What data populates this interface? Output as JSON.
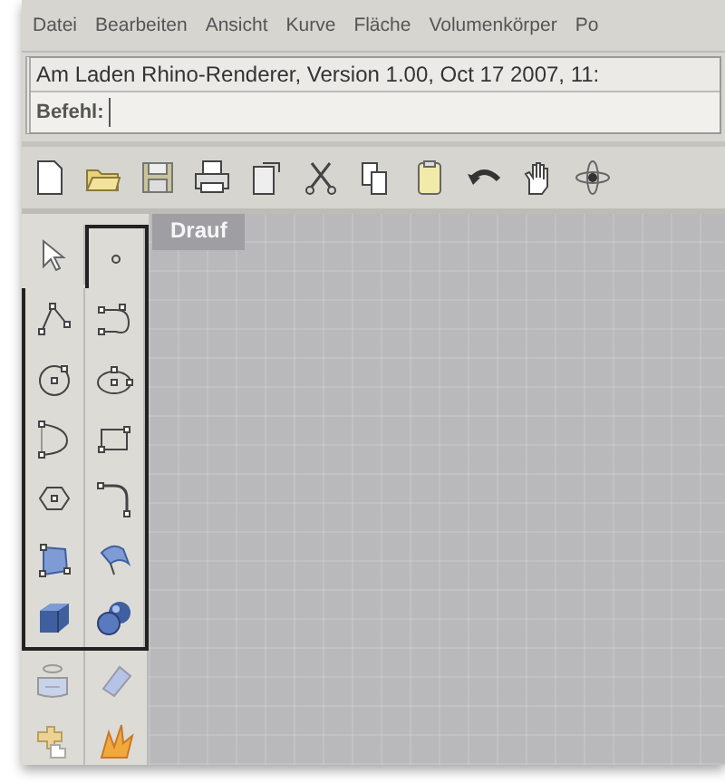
{
  "menu_bar": {
    "items": [
      {
        "label": "Datei"
      },
      {
        "label": "Bearbeiten"
      },
      {
        "label": "Ansicht"
      },
      {
        "label": "Kurve"
      },
      {
        "label": "Fläche"
      },
      {
        "label": "Volumenkörper"
      },
      {
        "label": "Po"
      }
    ]
  },
  "command_area": {
    "history": "Am Laden Rhino-Renderer, Version 1.00, Oct 17 2007, 11:",
    "prompt": "Befehl:"
  },
  "viewport": {
    "title": "Drauf"
  }
}
